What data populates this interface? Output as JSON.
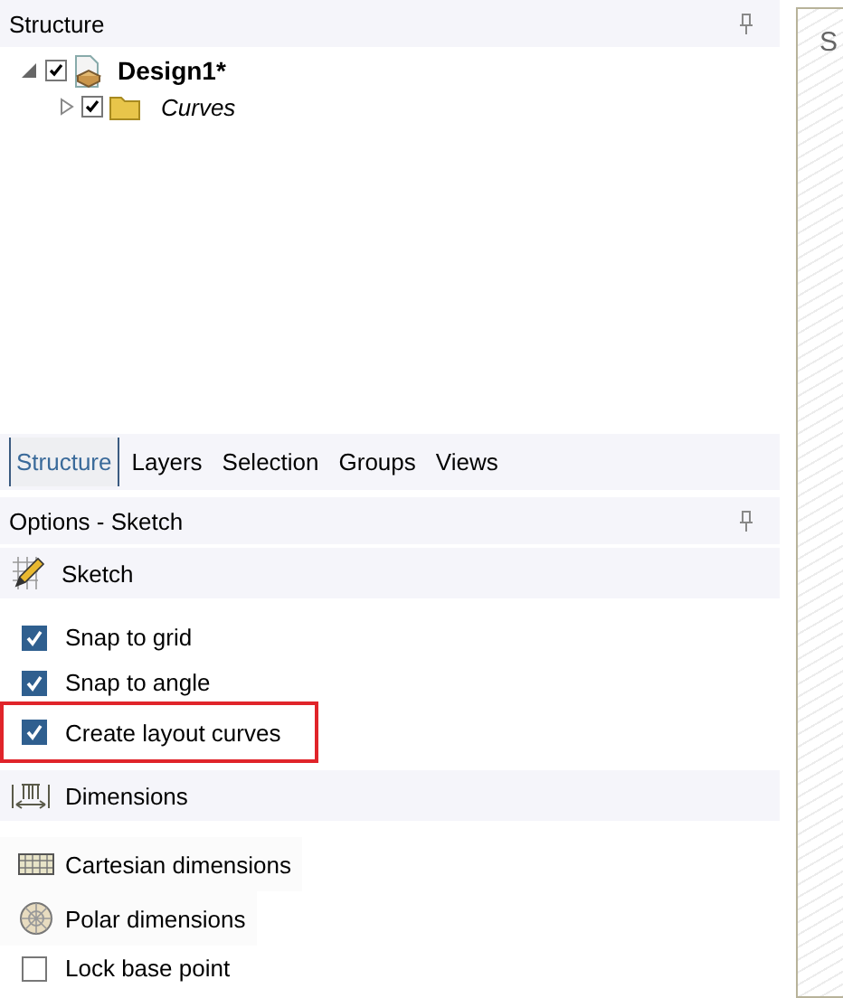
{
  "structure_panel": {
    "title": "Structure",
    "tree": [
      {
        "label": "Design1*",
        "kind": "design",
        "checked": true,
        "expanded": true,
        "children": [
          {
            "label": "Curves",
            "kind": "folder",
            "checked": true,
            "expanded": false
          }
        ]
      }
    ]
  },
  "tabs": [
    {
      "label": "Structure",
      "selected": true
    },
    {
      "label": "Layers",
      "selected": false
    },
    {
      "label": "Selection",
      "selected": false
    },
    {
      "label": "Groups",
      "selected": false
    },
    {
      "label": "Views",
      "selected": false
    }
  ],
  "options_panel": {
    "title": "Options - Sketch",
    "sections": [
      {
        "title": "Sketch",
        "kind": "sketch",
        "items": [
          {
            "kind": "checkbox",
            "label": "Snap to grid",
            "checked": true,
            "highlighted": false
          },
          {
            "kind": "checkbox",
            "label": "Snap to angle",
            "checked": true,
            "highlighted": false
          },
          {
            "kind": "checkbox",
            "label": "Create layout curves",
            "checked": true,
            "highlighted": true
          }
        ]
      },
      {
        "title": "Dimensions",
        "kind": "dimensions",
        "items": [
          {
            "kind": "cartesian",
            "label": "Cartesian dimensions"
          },
          {
            "kind": "polar",
            "label": "Polar dimensions"
          },
          {
            "kind": "checkbox",
            "label": "Lock base point",
            "checked": false,
            "highlighted": false
          }
        ]
      }
    ]
  },
  "canvas": {
    "title": "S"
  }
}
